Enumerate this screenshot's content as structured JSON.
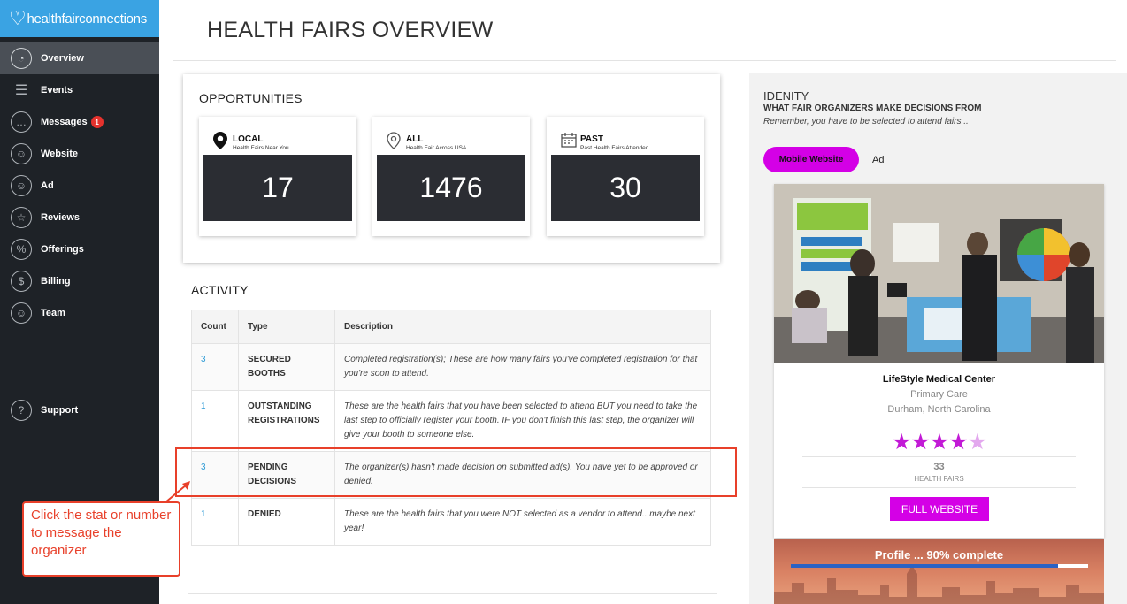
{
  "app": {
    "logo_text": "healthfairconnections"
  },
  "sidebar": {
    "items": [
      {
        "label": "Overview",
        "icon": "gauge-icon"
      },
      {
        "label": "Events",
        "icon": "list-icon"
      },
      {
        "label": "Messages",
        "icon": "chat-icon",
        "badge": "1"
      },
      {
        "label": "Website",
        "icon": "user-icon"
      },
      {
        "label": "Ad",
        "icon": "user-icon"
      },
      {
        "label": "Reviews",
        "icon": "star-icon"
      },
      {
        "label": "Offerings",
        "icon": "tag-icon"
      },
      {
        "label": "Billing",
        "icon": "dollar-icon"
      },
      {
        "label": "Team",
        "icon": "user-icon"
      }
    ],
    "support": {
      "label": "Support",
      "icon": "help-icon"
    }
  },
  "header": {
    "title": "HEALTH FAIRS OVERVIEW"
  },
  "opportunities": {
    "title": "OPPORTUNITIES",
    "stats": [
      {
        "label": "LOCAL",
        "sub": "Health Fairs Near You",
        "value": "17",
        "icon": "map-pin-icon"
      },
      {
        "label": "ALL",
        "sub": "Health Fair Across USA",
        "value": "1476",
        "icon": "location-icon"
      },
      {
        "label": "PAST",
        "sub": "Past Health Fairs Attended",
        "value": "30",
        "icon": "calendar-icon"
      }
    ]
  },
  "activity": {
    "title": "ACTIVITY",
    "columns": [
      "Count",
      "Type",
      "Description"
    ],
    "rows": [
      {
        "count": "3",
        "type": "SECURED BOOTHS",
        "description": "Completed registration(s); These are how many fairs you've completed registration for that you're soon to attend."
      },
      {
        "count": "1",
        "type": "OUTSTANDING REGISTRATIONS",
        "description": "These are the health fairs that you have been selected to attend BUT you need to take the last step to officially register your booth. IF you don't finish this last step, the organizer will give your booth to someone else."
      },
      {
        "count": "3",
        "type": "PENDING DECISIONS",
        "description": "The organizer(s) hasn't made decision on submitted ad(s). You have yet to be approved or denied."
      },
      {
        "count": "1",
        "type": "DENIED",
        "description": "These are the health fairs that you were NOT selected as a vendor to attend...maybe next year!"
      }
    ]
  },
  "callout": {
    "text": "Click the stat or number to message the organizer"
  },
  "identity": {
    "title": "IDENITY",
    "subtitle": "WHAT FAIR ORGANIZERS MAKE DECISIONS FROM",
    "note": "Remember, you have to be selected to attend fairs...",
    "tab_mobile": "Mobile Website",
    "tab_ad": "Ad",
    "profile": {
      "name": "LifeStyle Medical Center",
      "category": "Primary Care",
      "location": "Durham, North Carolina",
      "rating": 4.5,
      "fairs_count": "33",
      "fairs_label": "HEALTH FAIRS",
      "button": "FULL WEBSITE"
    },
    "profile_complete": {
      "text": "Profile ... 90% complete",
      "percent": 90
    }
  }
}
